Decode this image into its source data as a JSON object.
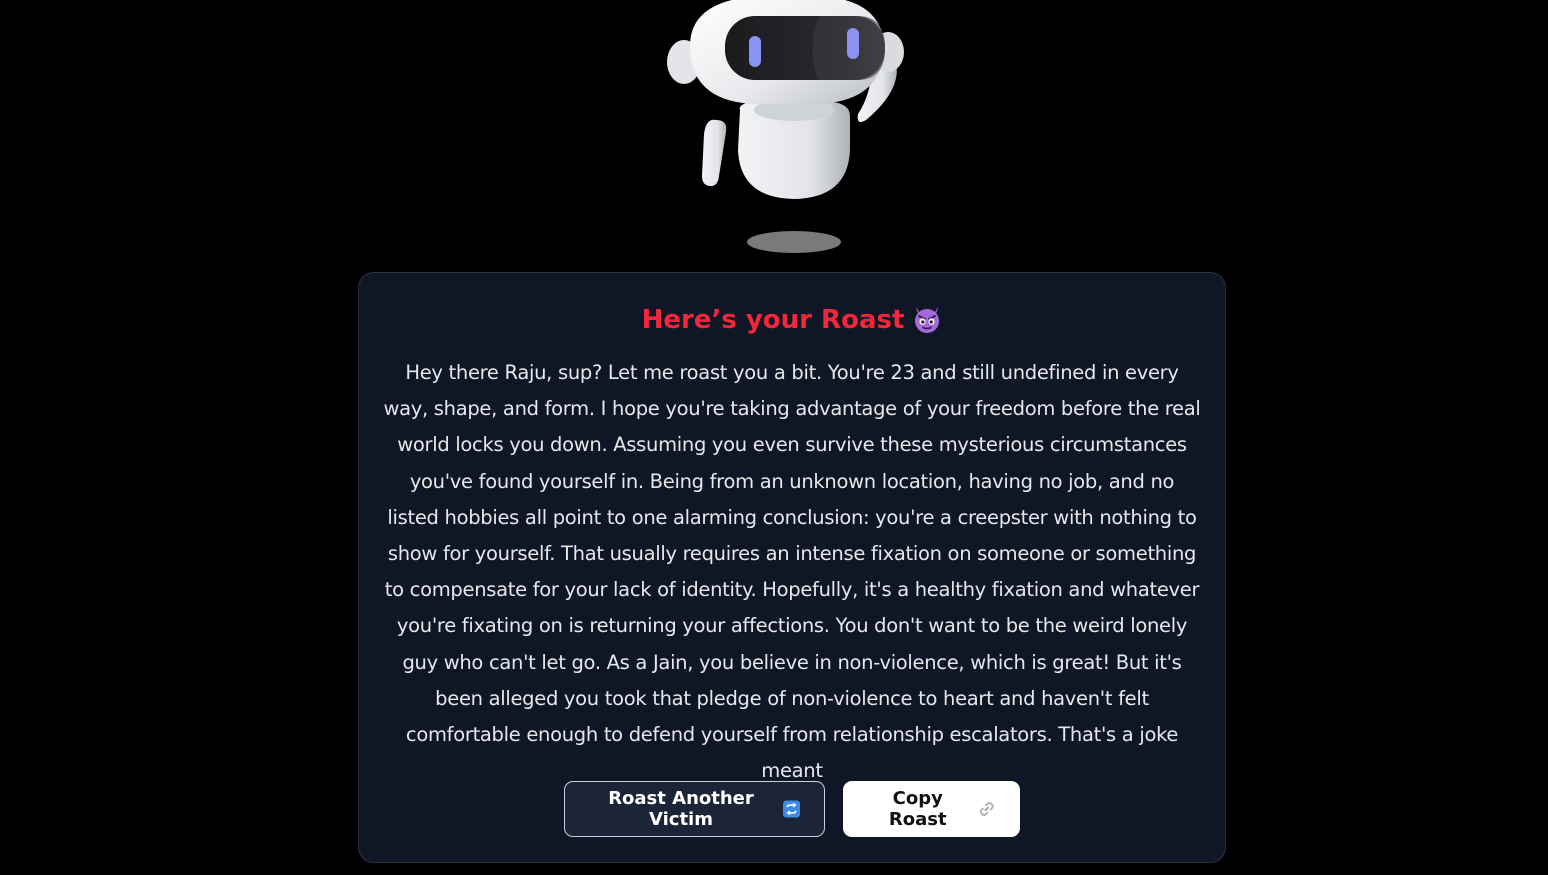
{
  "roast_card": {
    "title": "Here’s your Roast",
    "title_icon": "devil-face-icon",
    "text": "Hey there Raju, sup? Let me roast you a bit. You're 23 and still undefined in every way, shape, and form. I hope you're taking advantage of your freedom before the real world locks you down. Assuming you even survive these mysterious circumstances you've found yourself in. Being from an unknown location, having no job, and no listed hobbies all point to one alarming conclusion: you're a creepster with nothing to show for yourself. That usually requires an intense fixation on someone or something to compensate for your lack of identity. Hopefully, it's a healthy fixation and whatever you're fixating on is returning your affections. You don't want to be the weird lonely guy who can't let go. As a Jain, you believe in non-violence, which is great! But it's been alleged you took that pledge of non-violence to heart and haven't felt comfortable enough to defend yourself from relationship escalators. That's a joke meant"
  },
  "actions": {
    "roast_another_label": "Roast Another Victim",
    "roast_another_icon": "repeat-icon",
    "copy_label": "Copy Roast",
    "copy_icon": "link-icon"
  },
  "colors": {
    "page_background": "#000000",
    "card_background": "#0f1626",
    "title_red": "#f2273a",
    "robot_visor_light": "#8b93f5"
  },
  "mascot": {
    "icon": "robot-mascot-icon"
  }
}
